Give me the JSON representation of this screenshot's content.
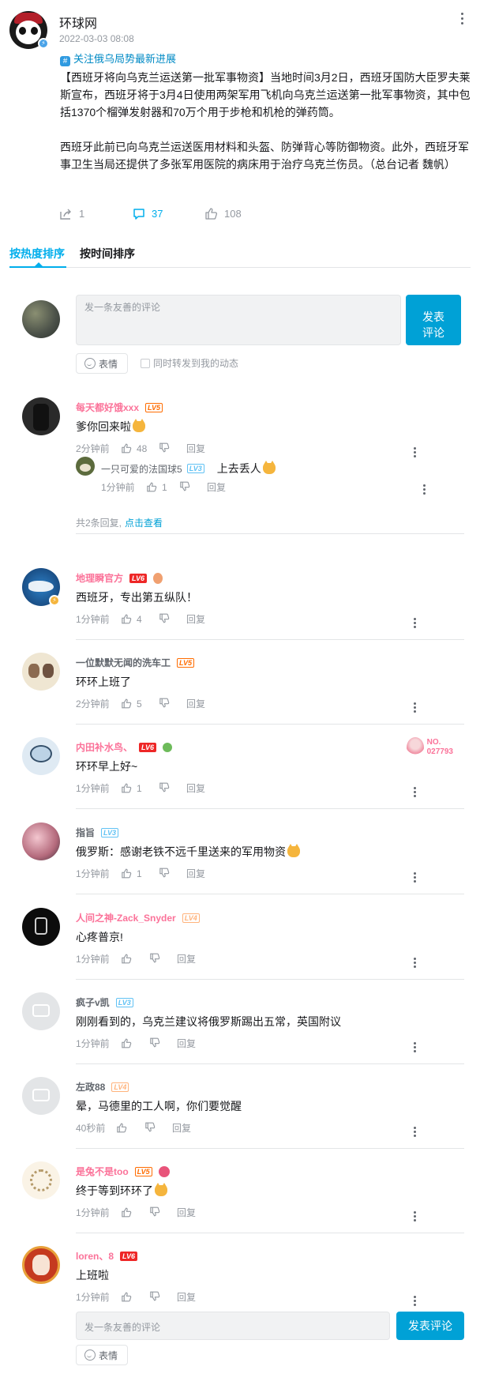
{
  "post": {
    "author": "环球网",
    "time": "2022-03-03 08:08",
    "topic": "关注俄乌局势最新进展",
    "paragraphs": [
      "【西班牙将向乌克兰运送第一批军事物资】当地时间3月2日，西班牙国防大臣罗夫莱斯宣布，西班牙将于3月4日使用两架军用飞机向乌克兰运送第一批军事物资，其中包括1370个榴弹发射器和70万个用于步枪和机枪的弹药筒。",
      "西班牙此前已向乌克兰运送医用材料和头盔、防弹背心等防御物资。此外，西班牙军事卫生当局还提供了多张军用医院的病床用于治疗乌克兰伤员。（总台记者 魏帆）"
    ],
    "stats": {
      "share": "1",
      "comment": "37",
      "like": "108"
    }
  },
  "tabs": {
    "hot": "按热度排序",
    "time": "按时间排序"
  },
  "comment_box": {
    "placeholder": "发一条友善的评论",
    "send": "发表\n评论",
    "emoji": "表情",
    "forward": "同时转发到我的动态"
  },
  "comments": [
    {
      "user": "每天都好饿xxx",
      "level": "LV5",
      "text": "爹你回来啦",
      "time": "2分钟前",
      "likes": "48",
      "reply_label": "回复",
      "reply": {
        "user": "一只可爱的法国球5",
        "level": "LV3",
        "text": "上去丢人",
        "time": "1分钟前",
        "likes": "1",
        "reply_label": "回复"
      },
      "reply_count": "共2条回复,",
      "reply_link": "点击查看"
    },
    {
      "user": "地理瞬官方",
      "level": "LV6",
      "text": "西班牙，专出第五纵队！",
      "time": "1分钟前",
      "likes": "4",
      "reply_label": "回复"
    },
    {
      "user": "一位默默无闻的洗车工",
      "level": "LV5",
      "text": "环环上班了",
      "time": "2分钟前",
      "likes": "5",
      "reply_label": "回复"
    },
    {
      "user": "内田补水鸟、",
      "level": "LV6",
      "text": "环环早上好~",
      "time": "1分钟前",
      "likes": "1",
      "reply_label": "回复",
      "fan_badge": "NO.\n027793"
    },
    {
      "user": "指旨",
      "level": "LV3",
      "text": "俄罗斯：感谢老铁不远千里送来的军用物资",
      "time": "1分钟前",
      "likes": "1",
      "reply_label": "回复"
    },
    {
      "user": "人间之神-Zack_Snyder",
      "level": "LV4",
      "text": "心疼普京!",
      "time": "1分钟前",
      "likes": "",
      "reply_label": "回复"
    },
    {
      "user": "疯子v凯",
      "level": "LV3",
      "text": "刚刚看到的，乌克兰建议将俄罗斯踢出五常，英国附议",
      "time": "1分钟前",
      "likes": "",
      "reply_label": "回复"
    },
    {
      "user": "左政88",
      "level": "LV4",
      "text": "晕，马德里的工人啊，你们要觉醒",
      "time": "40秒前",
      "likes": "",
      "reply_label": "回复"
    },
    {
      "user": "是兔不是too",
      "level": "LV5",
      "text": "终于等到环环了",
      "time": "1分钟前",
      "likes": "",
      "reply_label": "回复"
    },
    {
      "user": "loren、8",
      "level": "LV6",
      "text": "上班啦",
      "time": "1分钟前",
      "likes": "",
      "reply_label": "回复"
    }
  ],
  "bottom_box": {
    "placeholder": "发一条友善的评论",
    "send": "发表评论",
    "emoji": "表情"
  },
  "colors": {
    "accent": "#00aeec",
    "send_button": "#00a1d6",
    "vip_name": "#fb7299"
  },
  "icons": [
    "share-icon",
    "comment-icon",
    "like-icon",
    "dislike-icon",
    "smile-icon",
    "more-icon",
    "verify-icon",
    "topic-icon"
  ]
}
